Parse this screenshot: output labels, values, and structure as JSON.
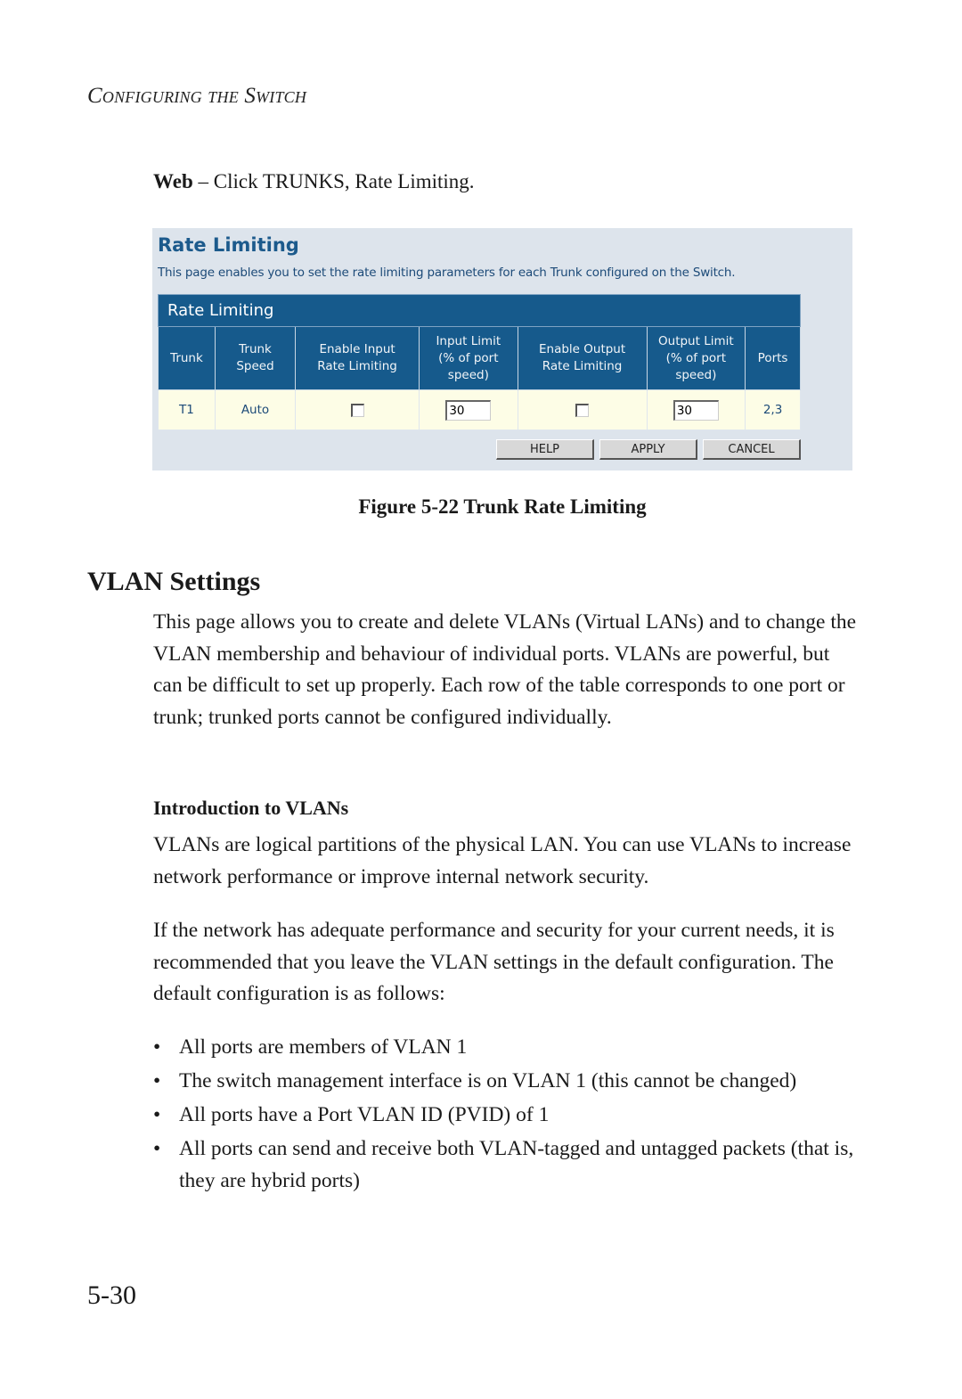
{
  "running_head": "Configuring the Switch",
  "web_instruction": {
    "prefix": "Web",
    "text": " – Click TRUNKS, Rate Limiting."
  },
  "screenshot": {
    "title": "Rate Limiting",
    "description": "This page enables you to set the rate limiting parameters for each Trunk configured on the Switch.",
    "table": {
      "caption": "Rate Limiting",
      "headers": [
        [
          "Trunk"
        ],
        [
          "Trunk",
          "Speed"
        ],
        [
          "Enable Input",
          "Rate Limiting"
        ],
        [
          "Input Limit",
          "(% of port",
          "speed)"
        ],
        [
          "Enable Output",
          "Rate Limiting"
        ],
        [
          "Output Limit",
          "(% of port",
          "speed)"
        ],
        [
          "Ports"
        ]
      ],
      "rows": [
        {
          "trunk": "T1",
          "speed": "Auto",
          "enable_input": false,
          "input_limit": "30",
          "enable_output": false,
          "output_limit": "30",
          "ports": "2,3"
        }
      ]
    },
    "buttons": {
      "help": "HELP",
      "apply": "APPLY",
      "cancel": "CANCEL"
    }
  },
  "figure_caption": "Figure 5-22  Trunk Rate Limiting",
  "section_title": "VLAN Settings",
  "intro_paragraph": "This page allows you to create and delete VLANs (Virtual LANs) and to change the VLAN membership and behaviour of individual ports. VLANs are powerful, but can be difficult to set up properly. Each row of the table corresponds to one port or trunk; trunked ports cannot be configured individually.",
  "subsection_title": "Introduction to VLANs",
  "paragraph_2": "VLANs are logical partitions of the physical LAN. You can use VLANs to increase network performance or improve internal network security.",
  "paragraph_3": "If the network has adequate performance and security for your current needs, it is recommended that you leave the VLAN settings in the default configuration. The default configuration is as follows:",
  "bullets": [
    "All ports are members of VLAN 1",
    "The switch management interface is on VLAN 1 (this cannot be changed)",
    "All ports have a Port VLAN ID (PVID) of 1",
    "All ports can send and receive both VLAN-tagged and untagged packets (that is, they are hybrid ports)"
  ],
  "bullet_glyph": "•",
  "page_number": "5-30"
}
